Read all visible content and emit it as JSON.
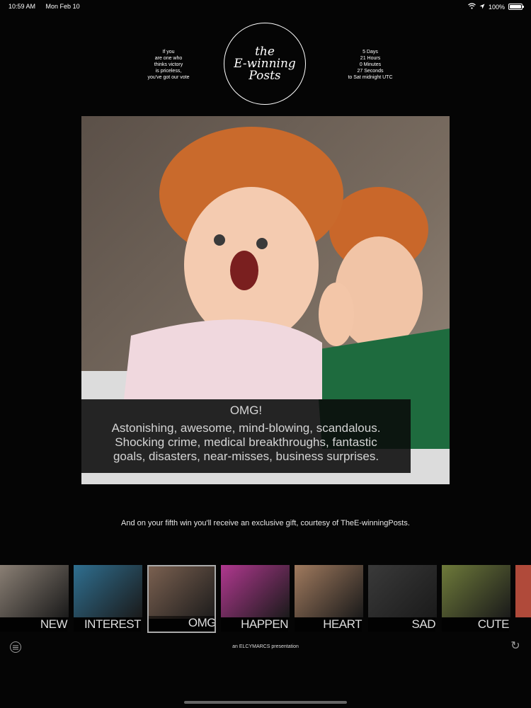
{
  "status_bar": {
    "time": "10:59 AM",
    "date": "Mon Feb 10",
    "battery": "100%"
  },
  "header": {
    "tagline": [
      "If you",
      "are one who",
      "thinks victory",
      "is priceless,",
      "you've got our vote"
    ],
    "logo_lines": [
      "the",
      "E-winning",
      "Posts"
    ],
    "countdown": [
      "5 Days",
      "21 Hours",
      "0 Minutes",
      "27 Seconds",
      "to Sat midnight UTC"
    ]
  },
  "hero": {
    "title": "OMG!",
    "description": "Astonishing, awesome, mind-blowing, scandalous.\nShocking crime, medical breakthroughs, fantastic\ngoals, disasters, near-misses, business surprises."
  },
  "gift_text": "And on your fifth win you'll receive an exclusive gift, courtesy of TheE-winningPosts.",
  "categories": [
    {
      "label": "NEW",
      "color": "#8a7f74"
    },
    {
      "label": "INTEREST",
      "color": "#2f6f90"
    },
    {
      "label": "OMG",
      "color": "#7a6050"
    },
    {
      "label": "HAPPEN",
      "color": "#b0388f"
    },
    {
      "label": "HEART",
      "color": "#a07a5e"
    },
    {
      "label": "SAD",
      "color": "#3a3a3a"
    },
    {
      "label": "CUTE",
      "color": "#6e7a3a"
    }
  ],
  "footer": {
    "presented_by": "an ELCYMARCS presentation"
  },
  "colors": {
    "background": "#050505",
    "caption_bg": "#0a0a0a"
  }
}
